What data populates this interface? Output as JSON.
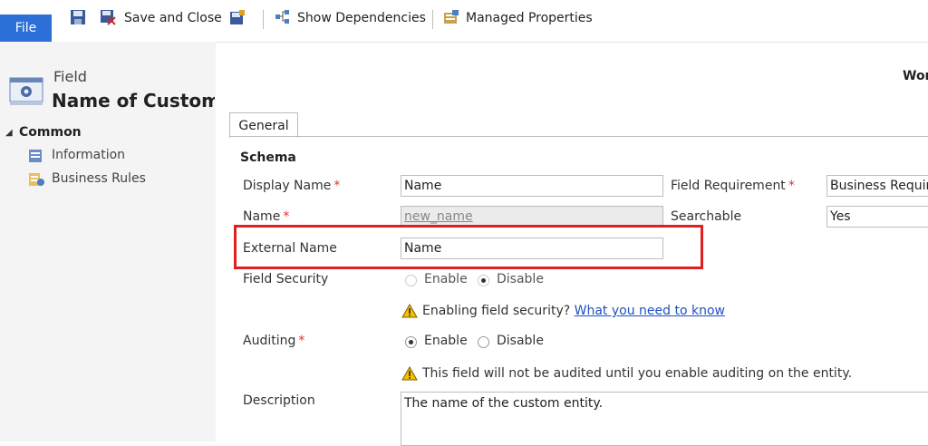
{
  "toolbar": {
    "file_label": "File",
    "save_close_label": "Save and Close",
    "show_dependencies_label": "Show Dependencies",
    "managed_properties_label": "Managed Properties"
  },
  "header": {
    "entity_type": "Field",
    "entity_name": "Name of Custome",
    "right_partial": "Wor"
  },
  "nav": {
    "section": "Common",
    "items": [
      "Information",
      "Business Rules"
    ]
  },
  "tabs": [
    "General"
  ],
  "form": {
    "section_title": "Schema",
    "display_name_label": "Display Name",
    "display_name_value": "Name",
    "name_label": "Name",
    "name_value": "new_name",
    "external_name_label": "External Name",
    "external_name_value": "Name",
    "field_security_label": "Field Security",
    "enable_label": "Enable",
    "disable_label": "Disable",
    "field_security_warning": "Enabling field security?",
    "field_security_link": "What you need to know",
    "auditing_label": "Auditing",
    "auditing_warning": "This field will not be audited until you enable auditing on the entity.",
    "description_label": "Description",
    "description_value": "The name of the custom entity.",
    "field_requirement_label": "Field Requirement",
    "field_requirement_value": "Business Require",
    "searchable_label": "Searchable",
    "searchable_value": "Yes"
  },
  "colors": {
    "file_button": "#2c6fd6",
    "highlight": "#e02020",
    "required": "#e03030",
    "link": "#2050c0"
  }
}
